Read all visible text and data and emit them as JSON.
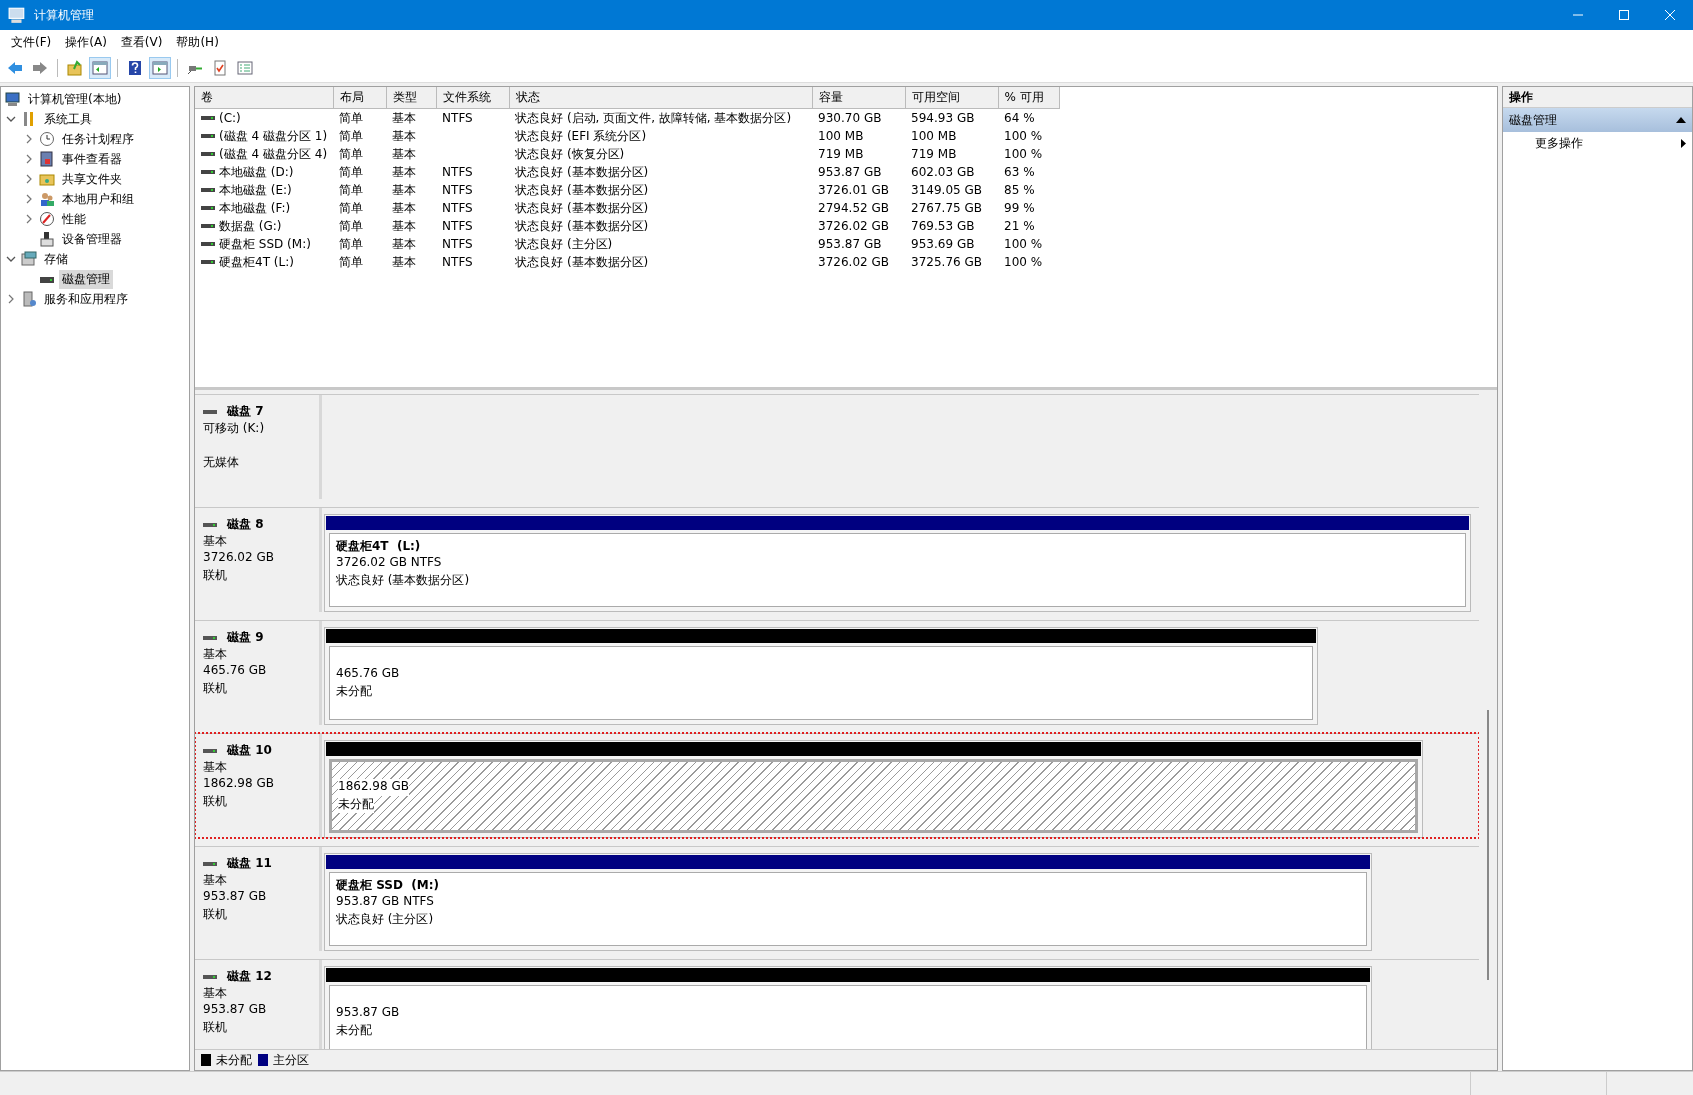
{
  "window": {
    "title": "计算机管理"
  },
  "menu": [
    "文件(F)",
    "操作(A)",
    "查看(V)",
    "帮助(H)"
  ],
  "toolbar": [
    {
      "kind": "back",
      "pressed": false
    },
    {
      "kind": "forward",
      "pressed": false
    },
    {
      "kind": "sep"
    },
    {
      "kind": "up",
      "pressed": false
    },
    {
      "kind": "tree",
      "pressed": true
    },
    {
      "kind": "sep"
    },
    {
      "kind": "help",
      "pressed": false
    },
    {
      "kind": "action",
      "pressed": true
    },
    {
      "kind": "sep"
    },
    {
      "kind": "connect",
      "pressed": false
    },
    {
      "kind": "check",
      "pressed": false
    },
    {
      "kind": "list",
      "pressed": false
    }
  ],
  "tree": [
    {
      "label": "计算机管理(本地)",
      "selected": false,
      "children": [
        {
          "label": "系统工具",
          "expanded": true,
          "selected": false,
          "children": [
            {
              "label": "任务计划程序",
              "expanded": false,
              "selected": false
            },
            {
              "label": "事件查看器",
              "expanded": false,
              "selected": false
            },
            {
              "label": "共享文件夹",
              "expanded": false,
              "selected": false
            },
            {
              "label": "本地用户和组",
              "expanded": false,
              "selected": false
            },
            {
              "label": "性能",
              "expanded": false,
              "selected": false
            },
            {
              "label": "设备管理器",
              "selected": false
            }
          ]
        },
        {
          "label": "存储",
          "expanded": true,
          "selected": false,
          "children": [
            {
              "label": "磁盘管理",
              "selected": true
            }
          ]
        },
        {
          "label": "服务和应用程序",
          "expanded": false,
          "selected": false
        }
      ]
    }
  ],
  "table": {
    "columns": [
      "卷",
      "布局",
      "类型",
      "文件系统",
      "状态",
      "容量",
      "可用空间",
      "% 可用"
    ],
    "rows": [
      [
        "(C:)",
        "简单",
        "基本",
        "NTFS",
        "状态良好 (启动, 页面文件, 故障转储, 基本数据分区)",
        "930.70 GB",
        "594.93 GB",
        "64 %"
      ],
      [
        "(磁盘 4 磁盘分区 1)",
        "简单",
        "基本",
        "",
        "状态良好 (EFI 系统分区)",
        "100 MB",
        "100 MB",
        "100 %"
      ],
      [
        "(磁盘 4 磁盘分区 4)",
        "简单",
        "基本",
        "",
        "状态良好 (恢复分区)",
        "719 MB",
        "719 MB",
        "100 %"
      ],
      [
        "本地磁盘 (D:)",
        "简单",
        "基本",
        "NTFS",
        "状态良好 (基本数据分区)",
        "953.87 GB",
        "602.03 GB",
        "63 %"
      ],
      [
        "本地磁盘 (E:)",
        "简单",
        "基本",
        "NTFS",
        "状态良好 (基本数据分区)",
        "3726.01 GB",
        "3149.05 GB",
        "85 %"
      ],
      [
        "本地磁盘 (F:)",
        "简单",
        "基本",
        "NTFS",
        "状态良好 (基本数据分区)",
        "2794.52 GB",
        "2767.75 GB",
        "99 %"
      ],
      [
        "数据盘 (G:)",
        "简单",
        "基本",
        "NTFS",
        "状态良好 (基本数据分区)",
        "3726.02 GB",
        "769.53 GB",
        "21 %"
      ],
      [
        "硬盘柜 SSD (M:)",
        "简单",
        "基本",
        "NTFS",
        "状态良好 (主分区)",
        "953.87 GB",
        "953.69 GB",
        "100 %"
      ],
      [
        "硬盘柜4T (L:)",
        "简单",
        "基本",
        "NTFS",
        "状态良好 (基本数据分区)",
        "3726.02 GB",
        "3725.76 GB",
        "100 %"
      ]
    ]
  },
  "disks": [
    {
      "name": "磁盘 7",
      "type": "可移动 (K:)",
      "status": "无媒体",
      "selected": false
    },
    {
      "name": "磁盘 8",
      "type": "基本",
      "capacity": "3726.02 GB",
      "status": "联机",
      "selected": false,
      "partitions": [
        {
          "kind": "primary",
          "title": "硬盘柜4T  (L:)",
          "lines": [
            "3726.02 GB NTFS",
            "状态良好 (基本数据分区)"
          ],
          "selected": false
        }
      ]
    },
    {
      "name": "磁盘 9",
      "type": "基本",
      "capacity": "465.76 GB",
      "status": "联机",
      "selected": false,
      "partitions": [
        {
          "kind": "unallocated",
          "lines": [
            "465.76 GB",
            "未分配"
          ],
          "selected": false
        }
      ]
    },
    {
      "name": "磁盘 10",
      "type": "基本",
      "capacity": "1862.98 GB",
      "status": "联机",
      "selected": true,
      "partitions": [
        {
          "kind": "unallocated",
          "lines": [
            "1862.98 GB",
            "未分配"
          ],
          "selected": true
        }
      ]
    },
    {
      "name": "磁盘 11",
      "type": "基本",
      "capacity": "953.87 GB",
      "status": "联机",
      "selected": false,
      "partitions": [
        {
          "kind": "primary",
          "title": "硬盘柜 SSD  (M:)",
          "lines": [
            "953.87 GB NTFS",
            "状态良好 (主分区)"
          ],
          "selected": false
        }
      ]
    },
    {
      "name": "磁盘 12",
      "type": "基本",
      "capacity": "953.87 GB",
      "status": "联机",
      "selected": false,
      "partitions": [
        {
          "kind": "unallocated",
          "lines": [
            "953.87 GB",
            "未分配"
          ],
          "selected": false
        }
      ]
    }
  ],
  "legend": [
    {
      "label": "未分配",
      "color": "#000000"
    },
    {
      "label": "主分区",
      "color": "#000080"
    }
  ],
  "actions": {
    "title": "操作",
    "sections": [
      {
        "label": "磁盘管理",
        "expanded": true,
        "items": [
          "更多操作"
        ]
      }
    ]
  }
}
